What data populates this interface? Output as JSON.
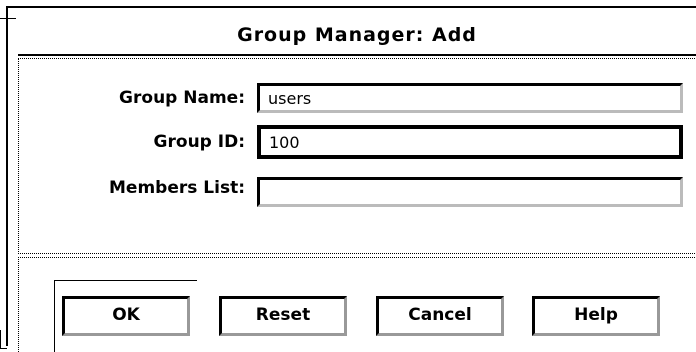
{
  "window": {
    "title": "Group Manager: Add"
  },
  "form": {
    "group_name": {
      "label": "Group Name:",
      "value": "users"
    },
    "group_id": {
      "label": "Group ID:",
      "value": "100"
    },
    "members_list": {
      "label": "Members List:",
      "value": ""
    }
  },
  "buttons": {
    "ok": "OK",
    "reset": "Reset",
    "cancel": "Cancel",
    "help": "Help"
  }
}
